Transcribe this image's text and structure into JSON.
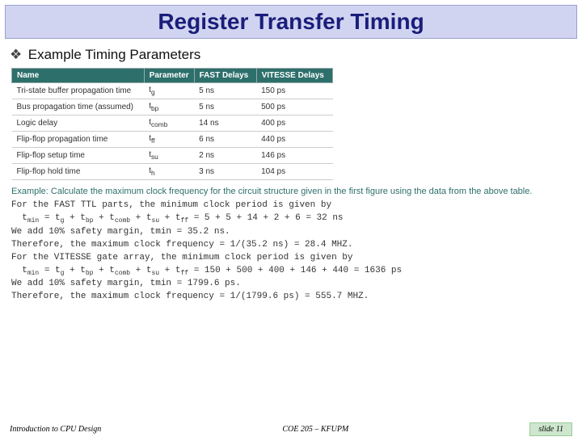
{
  "title": "Register Transfer Timing",
  "subtitle": "Example Timing Parameters",
  "table": {
    "headers": [
      "Name",
      "Parameter",
      "FAST Delays",
      "VITESSE Delays"
    ],
    "rows": [
      {
        "name": "Tri-state buffer propagation time",
        "param": "t_g",
        "fast": "5 ns",
        "vitesse": "150 ps"
      },
      {
        "name": "Bus propagation time (assumed)",
        "param": "t_bp",
        "fast": "5 ns",
        "vitesse": "500 ps"
      },
      {
        "name": "Logic delay",
        "param": "t_comb",
        "fast": "14 ns",
        "vitesse": "400 ps"
      },
      {
        "name": "Flip-flop propagation time",
        "param": "t_ff",
        "fast": "6 ns",
        "vitesse": "440 ps"
      },
      {
        "name": "Flip-flop setup time",
        "param": "t_su",
        "fast": "2 ns",
        "vitesse": "146 ps"
      },
      {
        "name": "Flip-flop hold time",
        "param": "t_h",
        "fast": "3 ns",
        "vitesse": "104 ps"
      }
    ]
  },
  "example_prompt": "Example: Calculate the maximum clock frequency for the circuit structure given in the first figure using the data from the above table.",
  "calc": {
    "l1": "For the FAST TTL parts, the minimum clock period is given by",
    "l2a": "  t",
    "l2b": " = t",
    "l2c": " + t",
    "l2d": " + t",
    "l2e": " + t",
    "l2f": " + t",
    "l2g": " = 5 + 5 + 14 + 2 + 6 = 32 ns",
    "l3": "We add 10% safety margin, tmin = 35.2 ns.",
    "l4": "Therefore, the maximum clock frequency = 1/(35.2 ns) = 28.4 MHZ.",
    "l5": "For the VITESSE gate array, the minimum clock period is given by",
    "l6g": " = 150 + 500 + 400 + 146 + 440 = 1636 ps",
    "l7": "We add 10% safety margin, tmin = 1799.6 ps.",
    "l8": "Therefore, the maximum clock frequency = 1/(1799.6 ps) = 555.7 MHZ.",
    "sub_min": "min",
    "sub_g": "g",
    "sub_bp": "bp",
    "sub_comb": "comb",
    "sub_su": "su",
    "sub_ff": "ff"
  },
  "footer": {
    "left": "Introduction to CPU Design",
    "center": "COE 205 – KFUPM",
    "right": "slide 11"
  }
}
